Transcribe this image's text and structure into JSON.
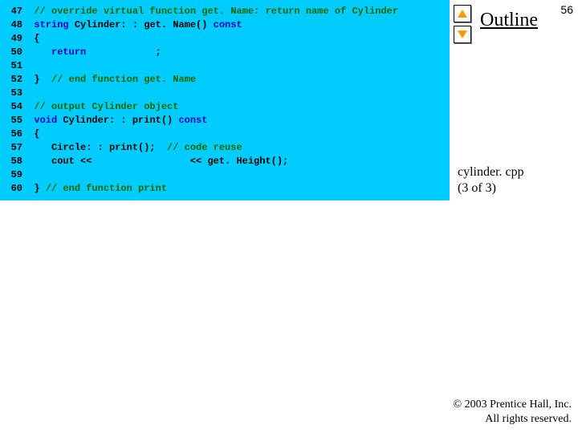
{
  "page_number": "56",
  "outline": "Outline",
  "file_label_line1": "cylinder. cpp",
  "file_label_line2": "(3 of 3)",
  "footer_line1": "© 2003 Prentice Hall, Inc.",
  "footer_line2": "All rights reserved.",
  "code": {
    "l47n": "47",
    "l47a": "// override virtual function get. Name: return name of Cylinder",
    "l48n": "48",
    "l48a": "string",
    "l48b": " Cylinder: : get. Name() ",
    "l48c": "const",
    "l49n": "49",
    "l49a": "{",
    "l50n": "50",
    "l50a": "   ",
    "l50b": "return",
    "l50c": "            ;",
    "l51n": "51",
    "l52n": "52",
    "l52a": "}  ",
    "l52b": "// end function get. Name",
    "l53n": "53",
    "l54n": "54",
    "l54a": "// output Cylinder object",
    "l55n": "55",
    "l55a": "void",
    "l55b": " Cylinder: : print() ",
    "l55c": "const",
    "l56n": "56",
    "l56a": "{",
    "l57n": "57",
    "l57a": "   Circle: : print();  ",
    "l57b": "// code reuse",
    "l58n": "58",
    "l58a": "   cout <<                 << get. Height();",
    "l59n": "59",
    "l60n": "60",
    "l60a": "} ",
    "l60b": "// end function print"
  }
}
